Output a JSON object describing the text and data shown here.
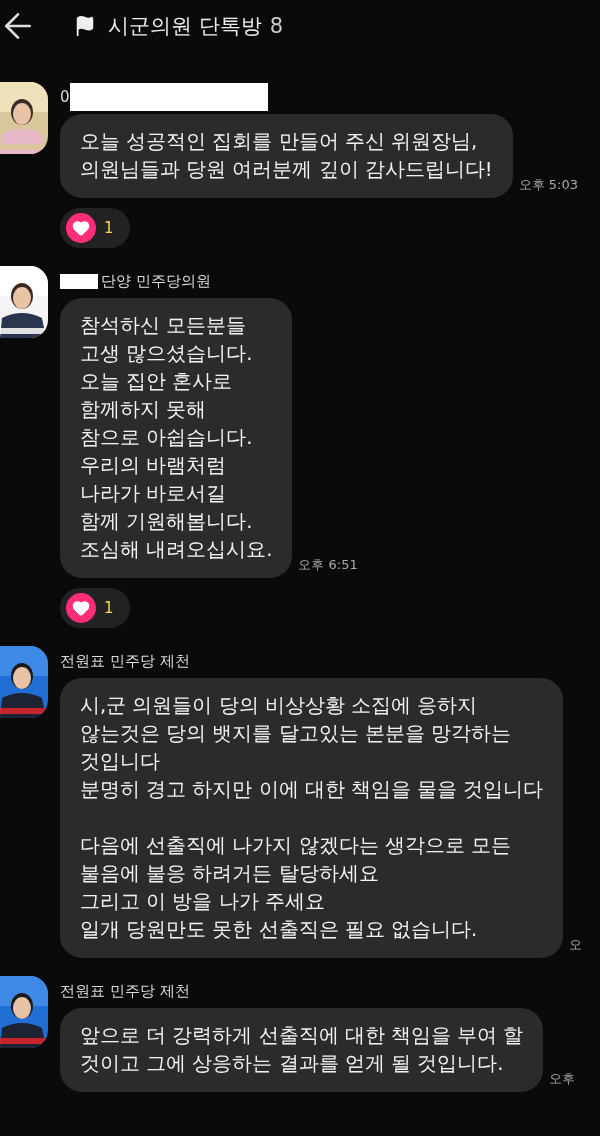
{
  "header": {
    "title": "시군의원 단톡방",
    "member_count": "8"
  },
  "messages": [
    {
      "sender_parts": [
        {
          "kind": "text",
          "text": "0"
        },
        {
          "kind": "redacted"
        }
      ],
      "paragraphs": [
        [
          "오늘 성공적인 집회를 만들어 주신 위원장님,",
          "의원님들과 당원 여러분께 깊이 감사드립니다!"
        ]
      ],
      "time": "오후 5:03",
      "reaction": {
        "count": "1"
      }
    },
    {
      "sender_parts": [
        {
          "kind": "redacted"
        },
        {
          "kind": "text",
          "text": "단양 민주당의원"
        }
      ],
      "paragraphs": [
        [
          "참석하신 모든분들",
          "고생 많으셨습니다.",
          "오늘 집안 혼사로",
          "함께하지 못해",
          "참으로 아쉽습니다.",
          "우리의 바램처럼",
          "나라가 바로서길",
          "함께 기원해봅니다.",
          "조심해 내려오십시요."
        ]
      ],
      "time": "오후 6:51",
      "reaction": {
        "count": "1"
      }
    },
    {
      "sender_parts": [
        {
          "kind": "text",
          "text": "전원표 민주당 제천"
        }
      ],
      "paragraphs": [
        [
          "시,군 의원들이 당의 비상상황 소집에 응하지",
          "않는것은 당의 뱃지를 달고있는 본분을 망각하는",
          "것입니다",
          "분명히 경고 하지만 이에 대한 책임을 물을 것입니다"
        ],
        [
          "다음에 선출직에 나가지 않겠다는 생각으로 모든",
          "불음에 불응 하려거든 탈당하세요",
          "그리고 이 방을 나가 주세요",
          "일개 당원만도 못한 선출직은 필요 없습니다."
        ]
      ],
      "time": "오"
    },
    {
      "sender_parts": [
        {
          "kind": "text",
          "text": "전원표 민주당 제천"
        }
      ],
      "paragraphs": [
        [
          "앞으로 더 강력하게 선출직에 대한 책임을 부여 할",
          "것이고 그에 상응하는 결과를 얻게 될 것입니다."
        ]
      ],
      "time": "오후"
    }
  ]
}
